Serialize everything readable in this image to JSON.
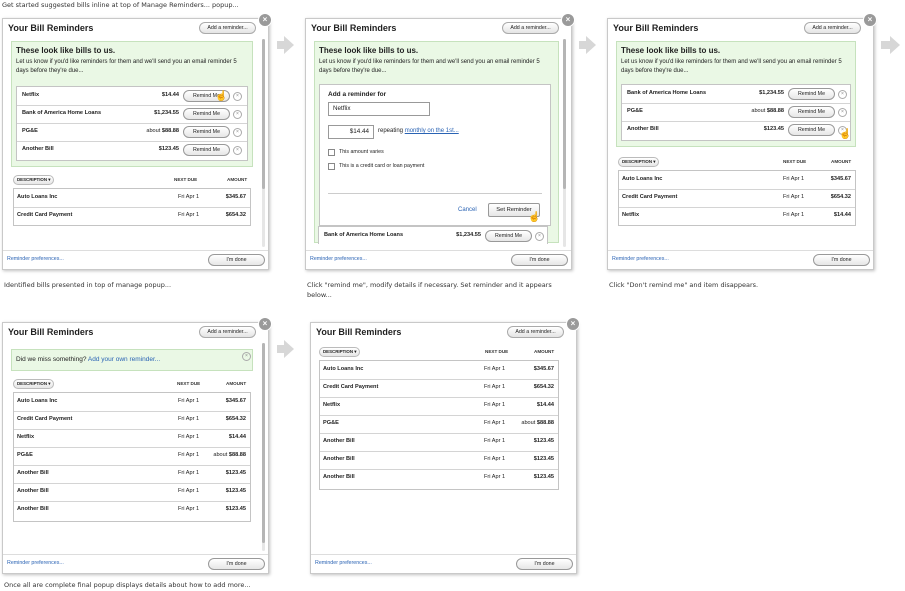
{
  "captions": {
    "top": "Get started suggested bills inline at top of Manage Reminders... popup...",
    "p1": "Identified bills presented in top of manage popup...",
    "p2": "Click \"remind me\", modify details if necessary. Set reminder and it appears below...",
    "p3": "Click \"Don't remind me\" and item disappears.",
    "p4": "Once all are complete final popup displays details about how to add more..."
  },
  "common": {
    "title": "Your Bill Reminders",
    "add_btn": "Add a reminder...",
    "close": "×",
    "prefs": "Reminder preferences...",
    "done": "I'm done",
    "remind": "Remind Me",
    "desc": "DESCRIPTION ▾",
    "next_due": "NEXT DUE",
    "amount": "AMOUNT",
    "suggest_title": "These look like bills to us.",
    "suggest_sub": "Let us know if you'd like reminders for them and we'll send you an email reminder 5 days before they're due...",
    "x": "×"
  },
  "p1": {
    "suggested": [
      {
        "name": "Netflix",
        "amt": "$14.44"
      },
      {
        "name": "Bank of America Home Loans",
        "amt": "$1,234.55"
      },
      {
        "name": "PG&E",
        "about": "about",
        "amt": "$88.88"
      },
      {
        "name": "Another Bill",
        "amt": "$123.45"
      }
    ],
    "list": [
      {
        "name": "Auto Loans Inc",
        "due": "Fri Apr 1",
        "amt": "$345.67"
      },
      {
        "name": "Credit Card Payment",
        "due": "Fri Apr 1",
        "amt": "$654.32"
      }
    ]
  },
  "p2": {
    "form_title": "Add a reminder for",
    "name_value": "Netflix",
    "amount_value": "$14.44",
    "repeating": "repeating",
    "repeat_link": "monthly on the 1st...",
    "varies": "This amount varies",
    "credit": "This is a credit card or loan payment",
    "cancel": "Cancel",
    "set": "Set Reminder",
    "next_row": {
      "name": "Bank of America Home Loans",
      "amt": "$1,234.55"
    }
  },
  "p3": {
    "suggested": [
      {
        "name": "Bank of America Home Loans",
        "amt": "$1,234.55"
      },
      {
        "name": "PG&E",
        "about": "about",
        "amt": "$88.88"
      },
      {
        "name": "Another Bill",
        "amt": "$123.45"
      }
    ],
    "list": [
      {
        "name": "Auto Loans Inc",
        "due": "Fri Apr 1",
        "amt": "$345.67"
      },
      {
        "name": "Credit Card Payment",
        "due": "Fri Apr 1",
        "amt": "$654.32"
      },
      {
        "name": "Netflix",
        "due": "Fri Apr 1",
        "amt": "$14.44"
      }
    ]
  },
  "p4": {
    "miss_text": "Did we miss something?",
    "miss_link": "Add your own reminder...",
    "list": [
      {
        "name": "Auto Loans Inc",
        "due": "Fri Apr 1",
        "amt": "$345.67"
      },
      {
        "name": "Credit Card Payment",
        "due": "Fri Apr 1",
        "amt": "$654.32"
      },
      {
        "name": "Netflix",
        "due": "Fri Apr 1",
        "amt": "$14.44"
      },
      {
        "name": "PG&E",
        "due": "Fri Apr 1",
        "about": "about",
        "amt": "$88.88"
      },
      {
        "name": "Another Bill",
        "due": "Fri Apr 1",
        "amt": "$123.45"
      },
      {
        "name": "Another Bill",
        "due": "Fri Apr 1",
        "amt": "$123.45"
      },
      {
        "name": "Another Bill",
        "due": "Fri Apr 1",
        "amt": "$123.45"
      }
    ]
  },
  "p5": {
    "list": [
      {
        "name": "Auto Loans Inc",
        "due": "Fri Apr 1",
        "amt": "$345.67"
      },
      {
        "name": "Credit Card Payment",
        "due": "Fri Apr 1",
        "amt": "$654.32"
      },
      {
        "name": "Netflix",
        "due": "Fri Apr 1",
        "amt": "$14.44"
      },
      {
        "name": "PG&E",
        "due": "Fri Apr 1",
        "about": "about",
        "amt": "$88.88"
      },
      {
        "name": "Another Bill",
        "due": "Fri Apr 1",
        "amt": "$123.45"
      },
      {
        "name": "Another Bill",
        "due": "Fri Apr 1",
        "amt": "$123.45"
      },
      {
        "name": "Another Bill",
        "due": "Fri Apr 1",
        "amt": "$123.45"
      }
    ]
  }
}
